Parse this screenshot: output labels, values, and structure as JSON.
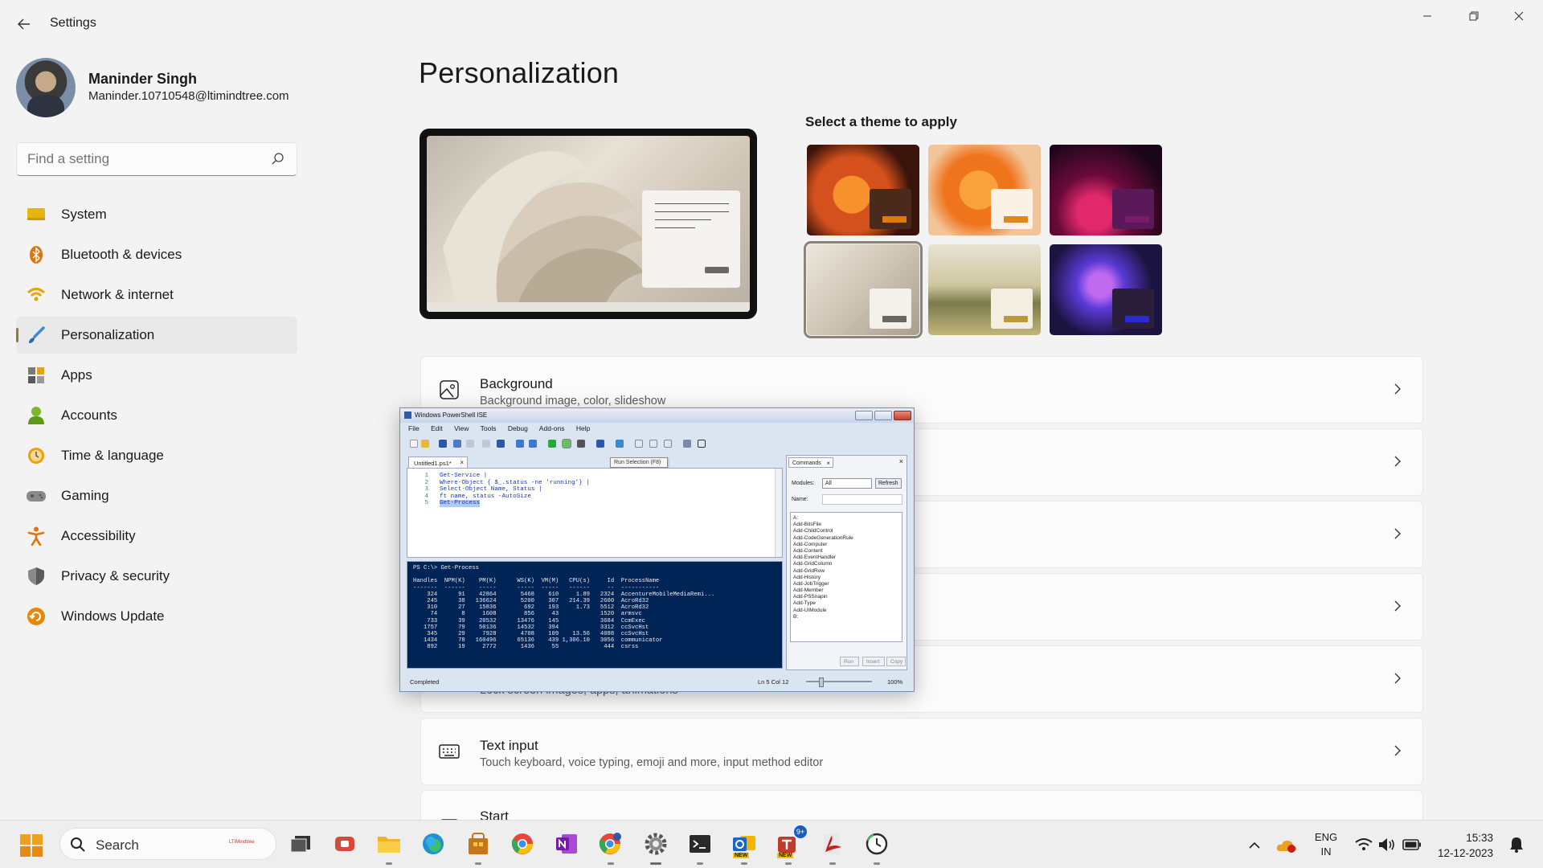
{
  "window": {
    "title": "Settings",
    "back_icon": "back-arrow-icon",
    "controls": [
      "minimize-icon",
      "restore-icon",
      "close-icon"
    ]
  },
  "profile": {
    "name": "Maninder Singh",
    "email": "Maninder.10710548@ltimindtree.com"
  },
  "search": {
    "placeholder": "Find a setting"
  },
  "nav": {
    "items": [
      {
        "label": "System",
        "icon": "system-icon"
      },
      {
        "label": "Bluetooth & devices",
        "icon": "bluetooth-icon"
      },
      {
        "label": "Network & internet",
        "icon": "wifi-icon"
      },
      {
        "label": "Personalization",
        "icon": "brush-icon",
        "active": true
      },
      {
        "label": "Apps",
        "icon": "apps-icon"
      },
      {
        "label": "Accounts",
        "icon": "accounts-icon"
      },
      {
        "label": "Time & language",
        "icon": "clock-icon"
      },
      {
        "label": "Gaming",
        "icon": "gamepad-icon"
      },
      {
        "label": "Accessibility",
        "icon": "accessibility-icon"
      },
      {
        "label": "Privacy & security",
        "icon": "shield-icon"
      },
      {
        "label": "Windows Update",
        "icon": "update-icon"
      }
    ]
  },
  "main": {
    "title": "Personalization",
    "theme_heading": "Select a theme to apply",
    "themes": [
      {
        "name": "theme-1",
        "bg": "#d4501c",
        "window": "#4a2a1a",
        "button": "#e07a10"
      },
      {
        "name": "theme-2",
        "bg": "#f29a3a",
        "window": "#fbf1e6",
        "button": "#e0861c"
      },
      {
        "name": "theme-3",
        "bg": "#4a0c3a",
        "window": "#5a1a5a",
        "button": "#7a1a6a"
      },
      {
        "name": "theme-4",
        "bg": "#d8cfc2",
        "window": "#f4f1ec",
        "button": "#6b665f",
        "selected": true
      },
      {
        "name": "theme-5",
        "bg": "#b7aa7a",
        "window": "#f2efe2",
        "button": "#b89a3a"
      },
      {
        "name": "theme-6",
        "bg": "#1c1440",
        "window": "#2a1e3a",
        "button": "#2a2ad6"
      }
    ],
    "cards": [
      {
        "title": "Background",
        "sub": "Background image, color, slideshow",
        "icon": "image-icon"
      },
      {
        "title": "",
        "sub": "",
        "icon": ""
      },
      {
        "title": "",
        "sub": "",
        "icon": ""
      },
      {
        "title": "",
        "sub": "",
        "icon": ""
      },
      {
        "title": "",
        "sub": "Lock screen images, apps, animations",
        "icon": ""
      },
      {
        "title": "Text input",
        "sub": "Touch keyboard, voice typing, emoji and more, input method editor",
        "icon": "keyboard-icon"
      },
      {
        "title": "Start",
        "sub": "",
        "icon": "start-icon"
      }
    ]
  },
  "ise": {
    "title": "Windows PowerShell ISE",
    "menu": [
      "File",
      "Edit",
      "View",
      "Tools",
      "Debug",
      "Add-ons",
      "Help"
    ],
    "tooltip": "Run Selection (F8)",
    "tab": "Untitled1.ps1*",
    "code": [
      {
        "n": "1",
        "text": "Get-Service |"
      },
      {
        "n": "2",
        "text": "Where-Object { $_.status -ne 'running'} |"
      },
      {
        "n": "3",
        "text": "Select-Object Name, Status |"
      },
      {
        "n": "4",
        "text": "ft name, status -AutoSize"
      },
      {
        "n": "5",
        "text": "Get-Process",
        "selected": true
      }
    ],
    "console": [
      "PS C:\\> Get-Process",
      "",
      "Handles  NPM(K)    PM(K)      WS(K)  VM(M)   CPU(s)     Id  ProcessName",
      "-------  ------    -----      -----  -----   ------     --  -----------",
      "    324      91    42864       5468    610     1.89   2324  AccentureMobileMediaRemi...",
      "    245      38   136624       5200    307   214.39   2600  AcroRd32",
      "    310      27    15836        692    193     1.73   5512  AcroRd32",
      "     74       8     1608        856     43            1520  armsvc",
      "    733      39    20532      13476    145            3684  CcmExec",
      "   1757      79    50136      14532    394            3312  ccSvcHst",
      "    345      29     7928       4708    109    13.56   4088  ccSvcHst",
      "   1434      78   160496      65136    439 1,306.10   3056  communicator",
      "    892      19     2772       1436     55             444  csrss"
    ],
    "commands": {
      "tab": "Commands",
      "modules_label": "Modules:",
      "modules_value": "All",
      "refresh": "Refresh",
      "name_label": "Name:",
      "list": [
        "A:",
        "Add-BitsFile",
        "Add-ChildControl",
        "Add-CodeGenerationRule",
        "Add-Computer",
        "Add-Content",
        "Add-EventHandler",
        "Add-GridColumn",
        "Add-GridRow",
        "Add-History",
        "Add-JobTrigger",
        "Add-Member",
        "Add-PSSnapin",
        "Add-Type",
        "Add-UIModule",
        "B:"
      ],
      "buttons": [
        "Run",
        "Insert",
        "Copy"
      ]
    },
    "status": {
      "left": "Completed",
      "pos": "Ln 5  Col 12",
      "zoom": "100%"
    }
  },
  "taskbar": {
    "search_text": "Search",
    "search_brand": "LTIMindtree",
    "apps": [
      {
        "name": "task-view-icon",
        "color": "#333333"
      },
      {
        "name": "teams-meet-icon",
        "color": "#d64a3a"
      },
      {
        "name": "file-explorer-icon",
        "color": "#f0b429",
        "running": true
      },
      {
        "name": "edge-icon",
        "color": "#1f8fd6"
      },
      {
        "name": "store-app-icon",
        "color": "#c8741a",
        "running": true
      },
      {
        "name": "chrome-icon",
        "color": "#3c8ee8"
      },
      {
        "name": "onenote-icon",
        "color": "#7719aa"
      },
      {
        "name": "chrome-profile-icon",
        "color": "#2a7ad0",
        "running": true
      },
      {
        "name": "settings-gear-icon",
        "color": "#555555",
        "running": true,
        "active": true
      },
      {
        "name": "terminal-icon",
        "color": "#2a2a2a",
        "running": true
      },
      {
        "name": "outlook-icon",
        "color": "#1a66c4",
        "running": true,
        "tag": "NEW"
      },
      {
        "name": "teams-icon",
        "color": "#c43a2a",
        "running": true,
        "badge": "9+",
        "tag": "NEW"
      },
      {
        "name": "acrobat-icon",
        "color": "#c4201a",
        "running": true
      },
      {
        "name": "clock-app-icon",
        "color": "#2a2a2a",
        "running": true
      }
    ],
    "tray": {
      "lang_line1": "ENG",
      "lang_line2": "IN",
      "time": "15:33",
      "date": "12-12-2023"
    }
  }
}
